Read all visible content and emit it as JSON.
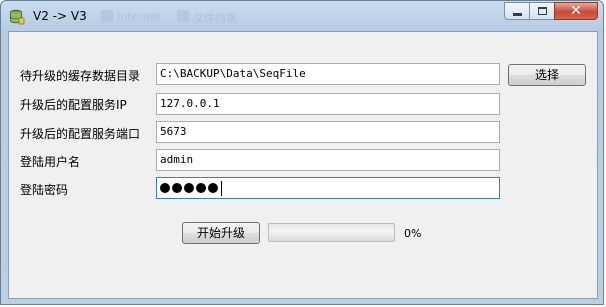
{
  "window": {
    "title": "V2 -> V3",
    "background_tabs": [
      "Internet",
      "文件档案"
    ],
    "controls": {
      "minimize": "minimize-icon",
      "maximize": "maximize-icon",
      "close": "close-icon"
    }
  },
  "form": {
    "cache_dir": {
      "label": "待升级的缓存数据目录",
      "value": "C:\\BACKUP\\Data\\SeqFile"
    },
    "config_ip": {
      "label": "升级后的配置服务IP",
      "value": "127.0.0.1"
    },
    "config_port": {
      "label": "升级后的配置服务端口",
      "value": "5673"
    },
    "username": {
      "label": "登陆用户名",
      "value": "admin"
    },
    "password": {
      "label": "登陆密码",
      "masked_length": 5
    }
  },
  "buttons": {
    "browse": "选择",
    "start": "开始升级"
  },
  "progress": {
    "value": 0,
    "label": "0%",
    "fill_color": "#37b44a"
  },
  "colors": {
    "title_bar": "#c9dbee",
    "close_button": "#c84a34",
    "client_bg": "#f0f0f0"
  }
}
